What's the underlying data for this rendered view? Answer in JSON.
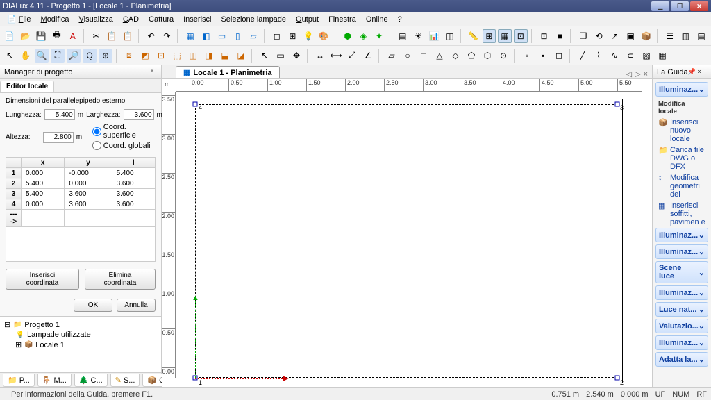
{
  "titlebar": {
    "text": "DIALux 4.11 - Progetto 1 - [Locale 1 - Planimetria]"
  },
  "menu": [
    "File",
    "Modifica",
    "Visualizza",
    "CAD",
    "Cattura",
    "Inserisci",
    "Selezione lampade",
    "Output",
    "Finestra",
    "Online",
    "?"
  ],
  "menu_hotkeys": [
    "F",
    "M",
    "V",
    "C",
    "",
    "",
    "",
    "O",
    "",
    "",
    ""
  ],
  "project_manager": {
    "title": "Manager di progetto"
  },
  "editor": {
    "tab": "Editor locale",
    "dim_title": "Dimensioni del parallelepipedo esterno",
    "length_label": "Lunghezza:",
    "length_value": "5.400",
    "width_label": "Larghezza:",
    "width_value": "3.600",
    "height_label": "Altezza:",
    "height_value": "2.800",
    "unit": "m",
    "coord_surface": "Coord. superficie",
    "coord_global": "Coord. globali",
    "table": {
      "headers": [
        "",
        "x",
        "y",
        "l"
      ],
      "rows": [
        [
          "1",
          "0.000",
          "-0.000",
          "5.400"
        ],
        [
          "2",
          "5.400",
          "0.000",
          "3.600"
        ],
        [
          "3",
          "5.400",
          "3.600",
          "3.600"
        ],
        [
          "4",
          "0.000",
          "3.600",
          "3.600"
        ],
        [
          "---->",
          "",
          "",
          ""
        ]
      ]
    },
    "insert_btn": "Inserisci coordinata",
    "delete_btn": "Elimina coordinata",
    "ok_btn": "OK",
    "cancel_btn": "Annulla"
  },
  "tree": {
    "project": "Progetto 1",
    "lamps": "Lampade utilizzate",
    "room": "Locale 1"
  },
  "bottom_tabs": [
    "P...",
    "M...",
    "C...",
    "S...",
    "O..."
  ],
  "canvas": {
    "tab_title": "Locale 1 - Planimetria",
    "ruler_unit": "m",
    "h_ticks": [
      "0.00",
      "0.50",
      "1.00",
      "1.50",
      "2.00",
      "2.50",
      "3.00",
      "3.50",
      "4.00",
      "4.50",
      "5.00",
      "5.50"
    ],
    "v_ticks": [
      "3.50",
      "3.00",
      "2.50",
      "2.00",
      "1.50",
      "1.00",
      "0.50",
      "0.00"
    ],
    "corner_labels": [
      "1",
      "2",
      "3",
      "4"
    ]
  },
  "guide": {
    "title": "La Guida",
    "top_btn": "Illuminaz...",
    "section_head": "Modifica locale",
    "items": [
      {
        "ic": "📦",
        "t": "Inserisci nuovo locale"
      },
      {
        "ic": "📁",
        "t": "Carica file DWG o DFX"
      },
      {
        "ic": "↕",
        "t": "Modifica geometri del"
      },
      {
        "ic": "▦",
        "t": "Inserisci soffitti, pavimen e"
      }
    ],
    "buttons": [
      "Illuminaz...",
      "Illuminaz...",
      "Scene luce",
      "Illuminaz...",
      "Luce nat...",
      "Valutazio...",
      "Illuminaz...",
      "Adatta la..."
    ]
  },
  "status": {
    "hint": "Per informazioni della Guida, premere F1.",
    "coord1": "0.751 m",
    "coord2": "2.540 m",
    "coord3": "0.000 m",
    "flags": [
      "UF",
      "NUM",
      "RF"
    ]
  }
}
